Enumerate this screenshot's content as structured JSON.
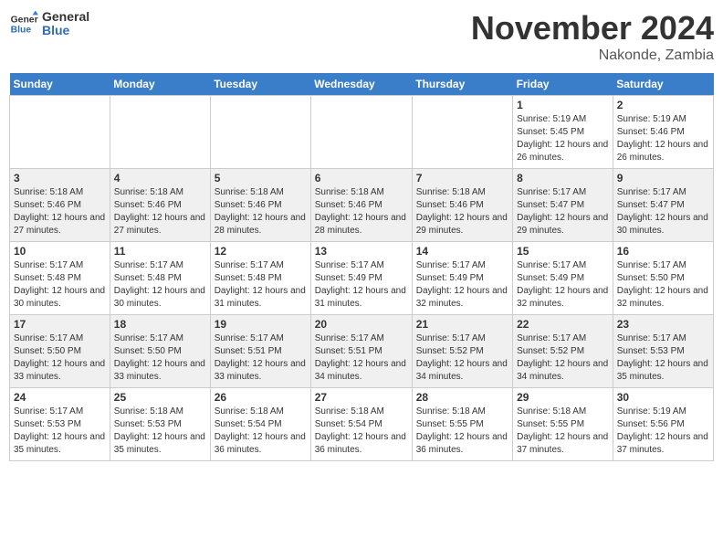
{
  "header": {
    "logo": {
      "general": "General",
      "blue": "Blue"
    },
    "title": "November 2024",
    "location": "Nakonde, Zambia"
  },
  "weekdays": [
    "Sunday",
    "Monday",
    "Tuesday",
    "Wednesday",
    "Thursday",
    "Friday",
    "Saturday"
  ],
  "weeks": [
    {
      "days": [
        {
          "num": "",
          "info": ""
        },
        {
          "num": "",
          "info": ""
        },
        {
          "num": "",
          "info": ""
        },
        {
          "num": "",
          "info": ""
        },
        {
          "num": "",
          "info": ""
        },
        {
          "num": "1",
          "info": "Sunrise: 5:19 AM\nSunset: 5:45 PM\nDaylight: 12 hours and 26 minutes."
        },
        {
          "num": "2",
          "info": "Sunrise: 5:19 AM\nSunset: 5:46 PM\nDaylight: 12 hours and 26 minutes."
        }
      ]
    },
    {
      "days": [
        {
          "num": "3",
          "info": "Sunrise: 5:18 AM\nSunset: 5:46 PM\nDaylight: 12 hours and 27 minutes."
        },
        {
          "num": "4",
          "info": "Sunrise: 5:18 AM\nSunset: 5:46 PM\nDaylight: 12 hours and 27 minutes."
        },
        {
          "num": "5",
          "info": "Sunrise: 5:18 AM\nSunset: 5:46 PM\nDaylight: 12 hours and 28 minutes."
        },
        {
          "num": "6",
          "info": "Sunrise: 5:18 AM\nSunset: 5:46 PM\nDaylight: 12 hours and 28 minutes."
        },
        {
          "num": "7",
          "info": "Sunrise: 5:18 AM\nSunset: 5:46 PM\nDaylight: 12 hours and 29 minutes."
        },
        {
          "num": "8",
          "info": "Sunrise: 5:17 AM\nSunset: 5:47 PM\nDaylight: 12 hours and 29 minutes."
        },
        {
          "num": "9",
          "info": "Sunrise: 5:17 AM\nSunset: 5:47 PM\nDaylight: 12 hours and 30 minutes."
        }
      ]
    },
    {
      "days": [
        {
          "num": "10",
          "info": "Sunrise: 5:17 AM\nSunset: 5:48 PM\nDaylight: 12 hours and 30 minutes."
        },
        {
          "num": "11",
          "info": "Sunrise: 5:17 AM\nSunset: 5:48 PM\nDaylight: 12 hours and 30 minutes."
        },
        {
          "num": "12",
          "info": "Sunrise: 5:17 AM\nSunset: 5:48 PM\nDaylight: 12 hours and 31 minutes."
        },
        {
          "num": "13",
          "info": "Sunrise: 5:17 AM\nSunset: 5:49 PM\nDaylight: 12 hours and 31 minutes."
        },
        {
          "num": "14",
          "info": "Sunrise: 5:17 AM\nSunset: 5:49 PM\nDaylight: 12 hours and 32 minutes."
        },
        {
          "num": "15",
          "info": "Sunrise: 5:17 AM\nSunset: 5:49 PM\nDaylight: 12 hours and 32 minutes."
        },
        {
          "num": "16",
          "info": "Sunrise: 5:17 AM\nSunset: 5:50 PM\nDaylight: 12 hours and 32 minutes."
        }
      ]
    },
    {
      "days": [
        {
          "num": "17",
          "info": "Sunrise: 5:17 AM\nSunset: 5:50 PM\nDaylight: 12 hours and 33 minutes."
        },
        {
          "num": "18",
          "info": "Sunrise: 5:17 AM\nSunset: 5:50 PM\nDaylight: 12 hours and 33 minutes."
        },
        {
          "num": "19",
          "info": "Sunrise: 5:17 AM\nSunset: 5:51 PM\nDaylight: 12 hours and 33 minutes."
        },
        {
          "num": "20",
          "info": "Sunrise: 5:17 AM\nSunset: 5:51 PM\nDaylight: 12 hours and 34 minutes."
        },
        {
          "num": "21",
          "info": "Sunrise: 5:17 AM\nSunset: 5:52 PM\nDaylight: 12 hours and 34 minutes."
        },
        {
          "num": "22",
          "info": "Sunrise: 5:17 AM\nSunset: 5:52 PM\nDaylight: 12 hours and 34 minutes."
        },
        {
          "num": "23",
          "info": "Sunrise: 5:17 AM\nSunset: 5:53 PM\nDaylight: 12 hours and 35 minutes."
        }
      ]
    },
    {
      "days": [
        {
          "num": "24",
          "info": "Sunrise: 5:17 AM\nSunset: 5:53 PM\nDaylight: 12 hours and 35 minutes."
        },
        {
          "num": "25",
          "info": "Sunrise: 5:18 AM\nSunset: 5:53 PM\nDaylight: 12 hours and 35 minutes."
        },
        {
          "num": "26",
          "info": "Sunrise: 5:18 AM\nSunset: 5:54 PM\nDaylight: 12 hours and 36 minutes."
        },
        {
          "num": "27",
          "info": "Sunrise: 5:18 AM\nSunset: 5:54 PM\nDaylight: 12 hours and 36 minutes."
        },
        {
          "num": "28",
          "info": "Sunrise: 5:18 AM\nSunset: 5:55 PM\nDaylight: 12 hours and 36 minutes."
        },
        {
          "num": "29",
          "info": "Sunrise: 5:18 AM\nSunset: 5:55 PM\nDaylight: 12 hours and 37 minutes."
        },
        {
          "num": "30",
          "info": "Sunrise: 5:19 AM\nSunset: 5:56 PM\nDaylight: 12 hours and 37 minutes."
        }
      ]
    }
  ]
}
